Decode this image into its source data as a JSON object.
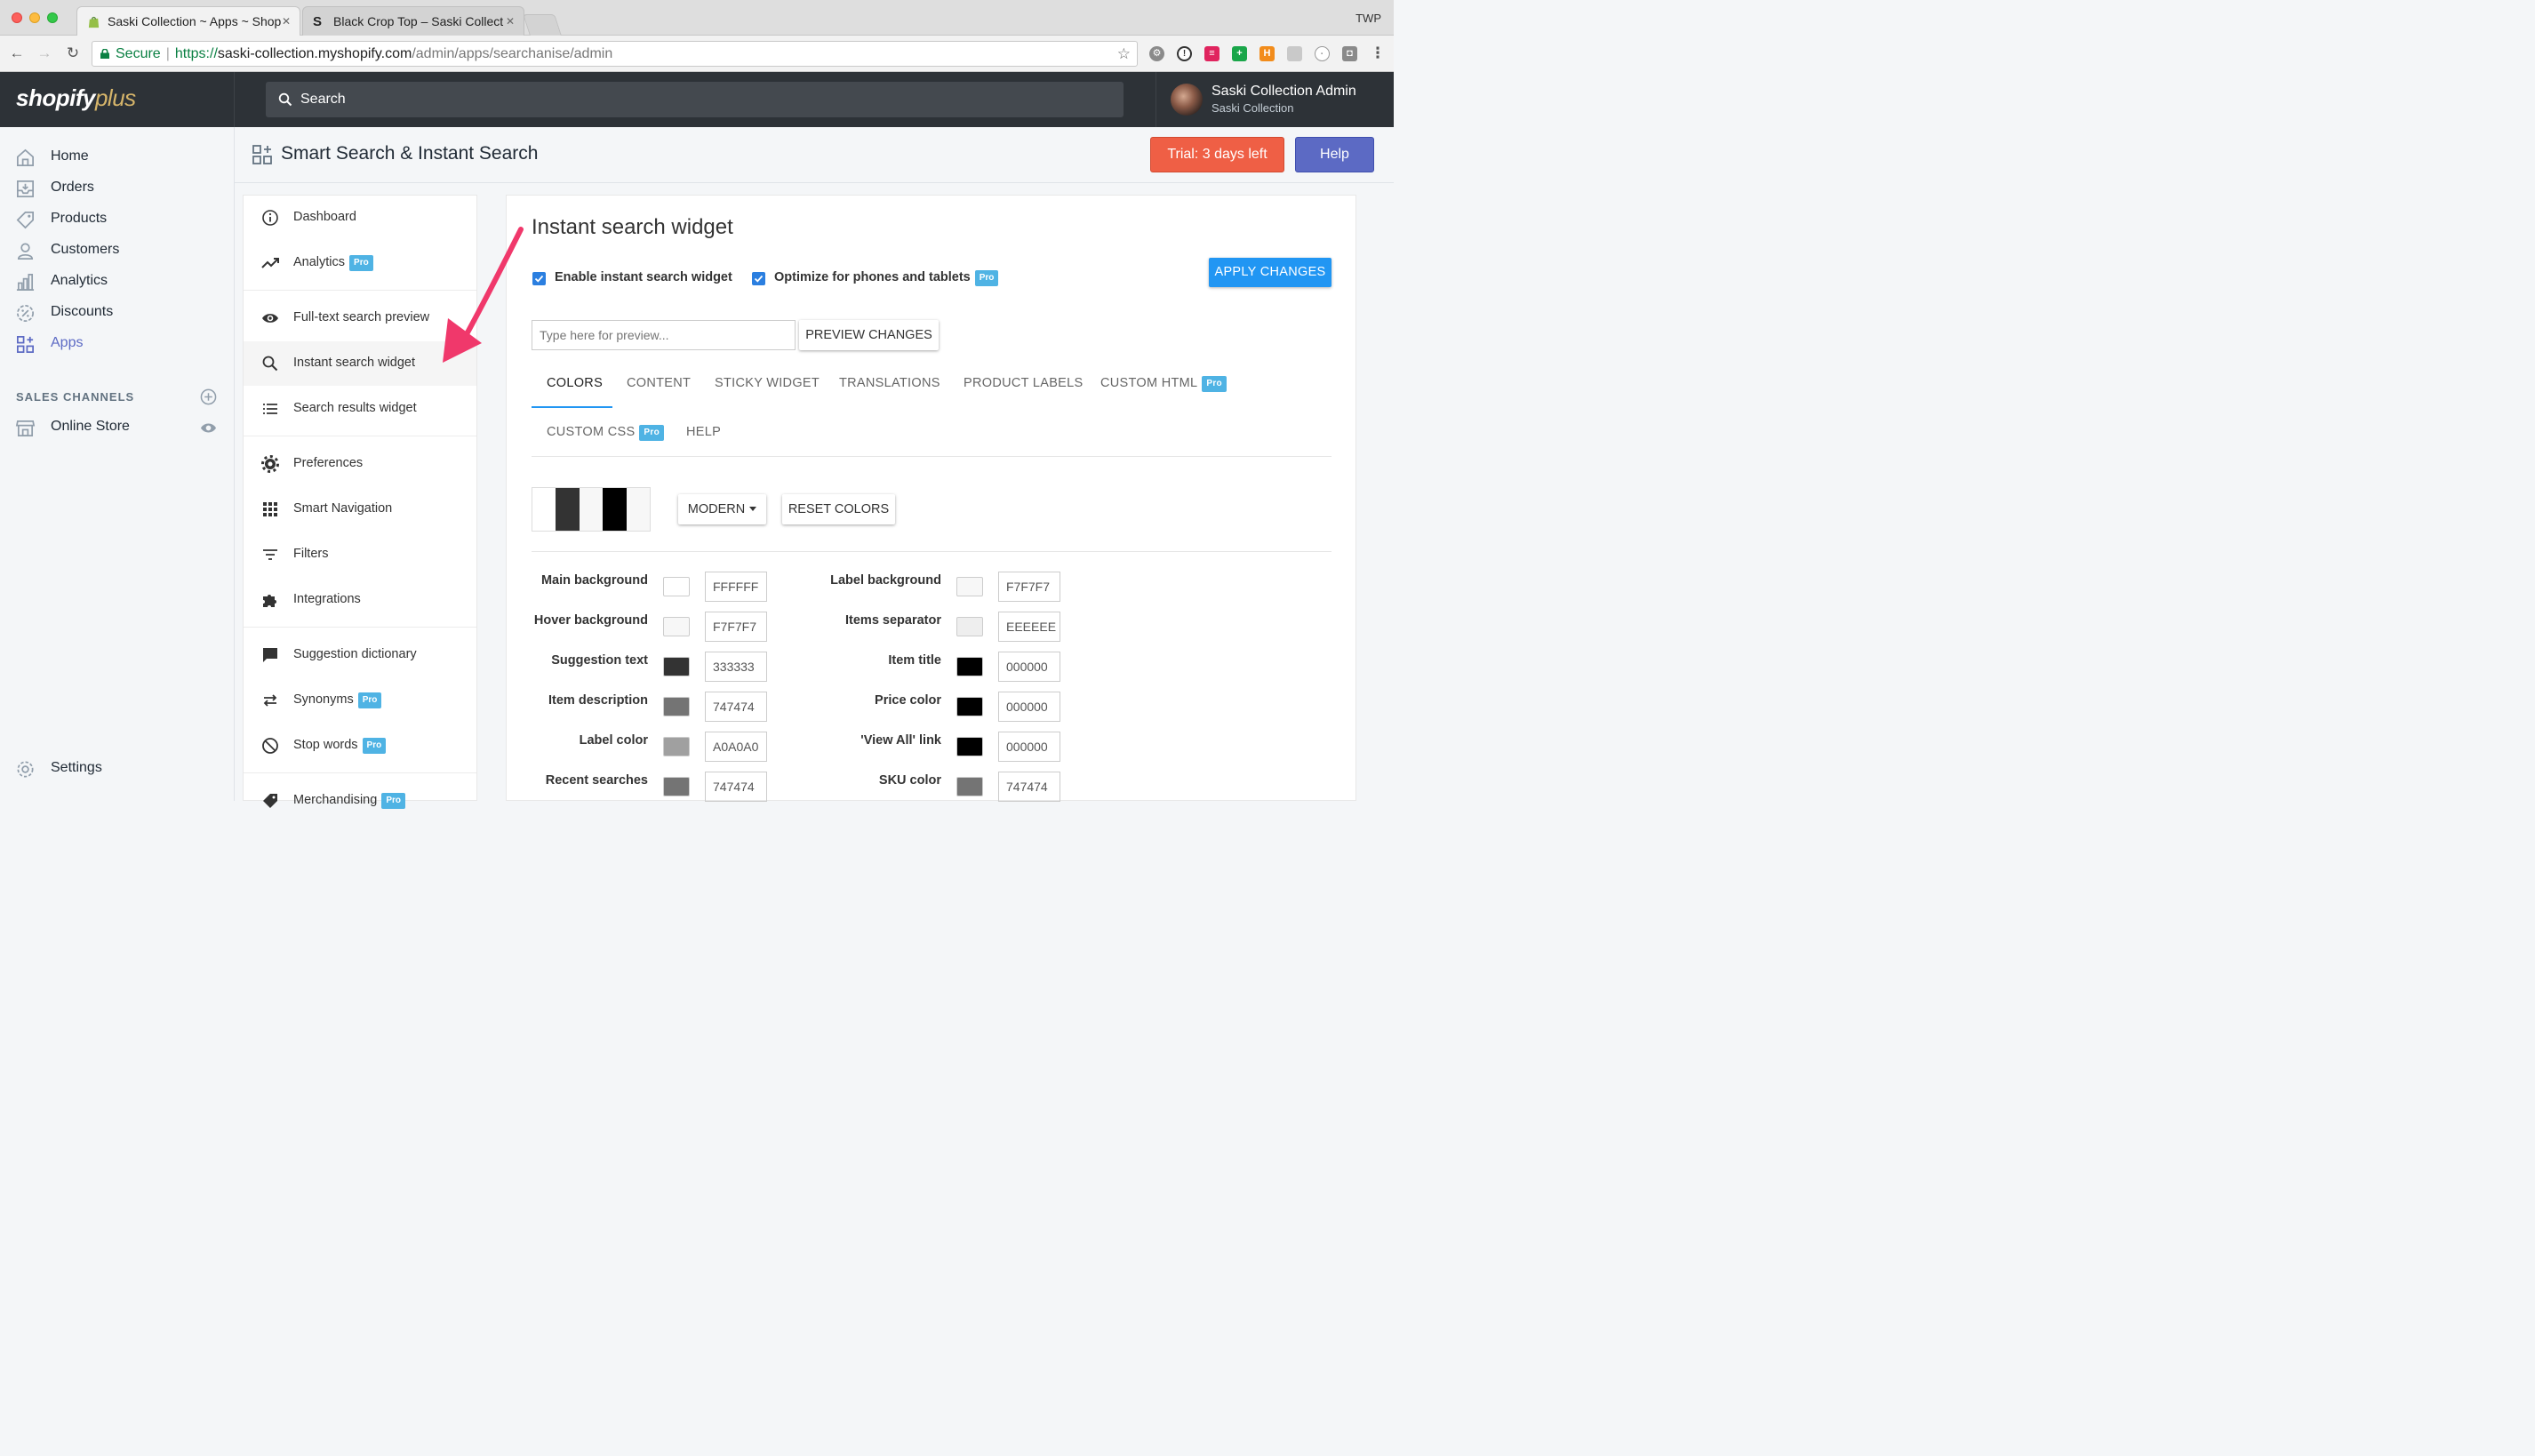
{
  "browser": {
    "tabs": [
      {
        "title": "Saski Collection ~ Apps ~ Shop",
        "active": true
      },
      {
        "title": "Black Crop Top – Saski Collect",
        "active": false
      }
    ],
    "profile": "TWP",
    "url": {
      "secure_label": "Secure",
      "protocol": "https://",
      "host": "saski-collection.myshopify.com",
      "path": "/admin/apps/searchanise/admin"
    }
  },
  "topbar": {
    "logo_main": "shopify",
    "logo_plus": "plus",
    "search_placeholder": "Search",
    "user_name": "Saski Collection Admin",
    "user_store": "Saski Collection"
  },
  "nav": {
    "items": [
      {
        "label": "Home",
        "icon": "home-icon"
      },
      {
        "label": "Orders",
        "icon": "orders-icon"
      },
      {
        "label": "Products",
        "icon": "tag-icon"
      },
      {
        "label": "Customers",
        "icon": "person-icon"
      },
      {
        "label": "Analytics",
        "icon": "bar-chart-icon"
      },
      {
        "label": "Discounts",
        "icon": "discount-icon"
      },
      {
        "label": "Apps",
        "icon": "apps-icon",
        "active": true
      }
    ],
    "sales_channels_heading": "SALES CHANNELS",
    "online_store": "Online Store",
    "settings": "Settings"
  },
  "page": {
    "title": "Smart Search & Instant Search",
    "trial_label": "Trial: 3 days left",
    "help_label": "Help"
  },
  "app_sidebar": {
    "pro_badge": "Pro",
    "items": [
      {
        "label": "Dashboard",
        "icon": "info-icon"
      },
      {
        "label": "Analytics",
        "icon": "trend-icon",
        "pro": true
      },
      {
        "label": "Full-text search preview",
        "icon": "eye-icon"
      },
      {
        "label": "Instant search widget",
        "icon": "search-icon",
        "active": true
      },
      {
        "label": "Search results widget",
        "icon": "list-icon"
      },
      {
        "label": "Preferences",
        "icon": "gear-icon"
      },
      {
        "label": "Smart Navigation",
        "icon": "grid-icon"
      },
      {
        "label": "Filters",
        "icon": "filter-icon"
      },
      {
        "label": "Integrations",
        "icon": "puzzle-icon"
      },
      {
        "label": "Suggestion dictionary",
        "icon": "chat-icon"
      },
      {
        "label": "Synonyms",
        "icon": "swap-icon",
        "pro": true
      },
      {
        "label": "Stop words",
        "icon": "block-icon",
        "pro": true
      },
      {
        "label": "Merchandising",
        "icon": "tag-icon",
        "pro": true
      }
    ]
  },
  "widget": {
    "title": "Instant search widget",
    "enable_label": "Enable instant search widget",
    "enable_checked": true,
    "optimize_label": "Optimize for phones and tablets",
    "optimize_checked": true,
    "apply_label": "APPLY CHANGES",
    "preview_placeholder": "Type here for preview...",
    "preview_button": "PREVIEW CHANGES",
    "tabs_row1": [
      "COLORS",
      "CONTENT",
      "STICKY WIDGET",
      "TRANSLATIONS",
      "PRODUCT LABELS",
      "CUSTOM HTML"
    ],
    "tabs_row2": [
      "CUSTOM CSS",
      "HELP"
    ],
    "active_tab": "COLORS",
    "theme_select": "MODERN",
    "reset_label": "RESET COLORS",
    "theme_swatch_colors": [
      "#FFFFFF",
      "#333333",
      "#F7F7F7",
      "#000000",
      "#F7F7F7"
    ],
    "colors_left": [
      {
        "label": "Main background",
        "hex": "FFFFFF",
        "color": "#FFFFFF"
      },
      {
        "label": "Hover background",
        "hex": "F7F7F7",
        "color": "#F7F7F7"
      },
      {
        "label": "Suggestion text",
        "hex": "333333",
        "color": "#333333"
      },
      {
        "label": "Item description",
        "hex": "747474",
        "color": "#747474"
      },
      {
        "label": "Label color",
        "hex": "A0A0A0",
        "color": "#A0A0A0"
      },
      {
        "label": "Recent searches",
        "hex": "747474",
        "color": "#747474"
      }
    ],
    "colors_right": [
      {
        "label": "Label background",
        "hex": "F7F7F7",
        "color": "#F7F7F7"
      },
      {
        "label": "Items separator",
        "hex": "EEEEEE",
        "color": "#EEEEEE"
      },
      {
        "label": "Item title",
        "hex": "000000",
        "color": "#000000"
      },
      {
        "label": "Price color",
        "hex": "000000",
        "color": "#000000"
      },
      {
        "label": "'View All' link",
        "hex": "000000",
        "color": "#000000"
      },
      {
        "label": "SKU color",
        "hex": "747474",
        "color": "#747474"
      }
    ]
  },
  "colors": {
    "accent": "#5c6ac4",
    "trial": "#ef5f45",
    "primary_blue": "#2196f3",
    "pro_badge": "#4fb3e4",
    "annotation_arrow": "#f0386b"
  }
}
